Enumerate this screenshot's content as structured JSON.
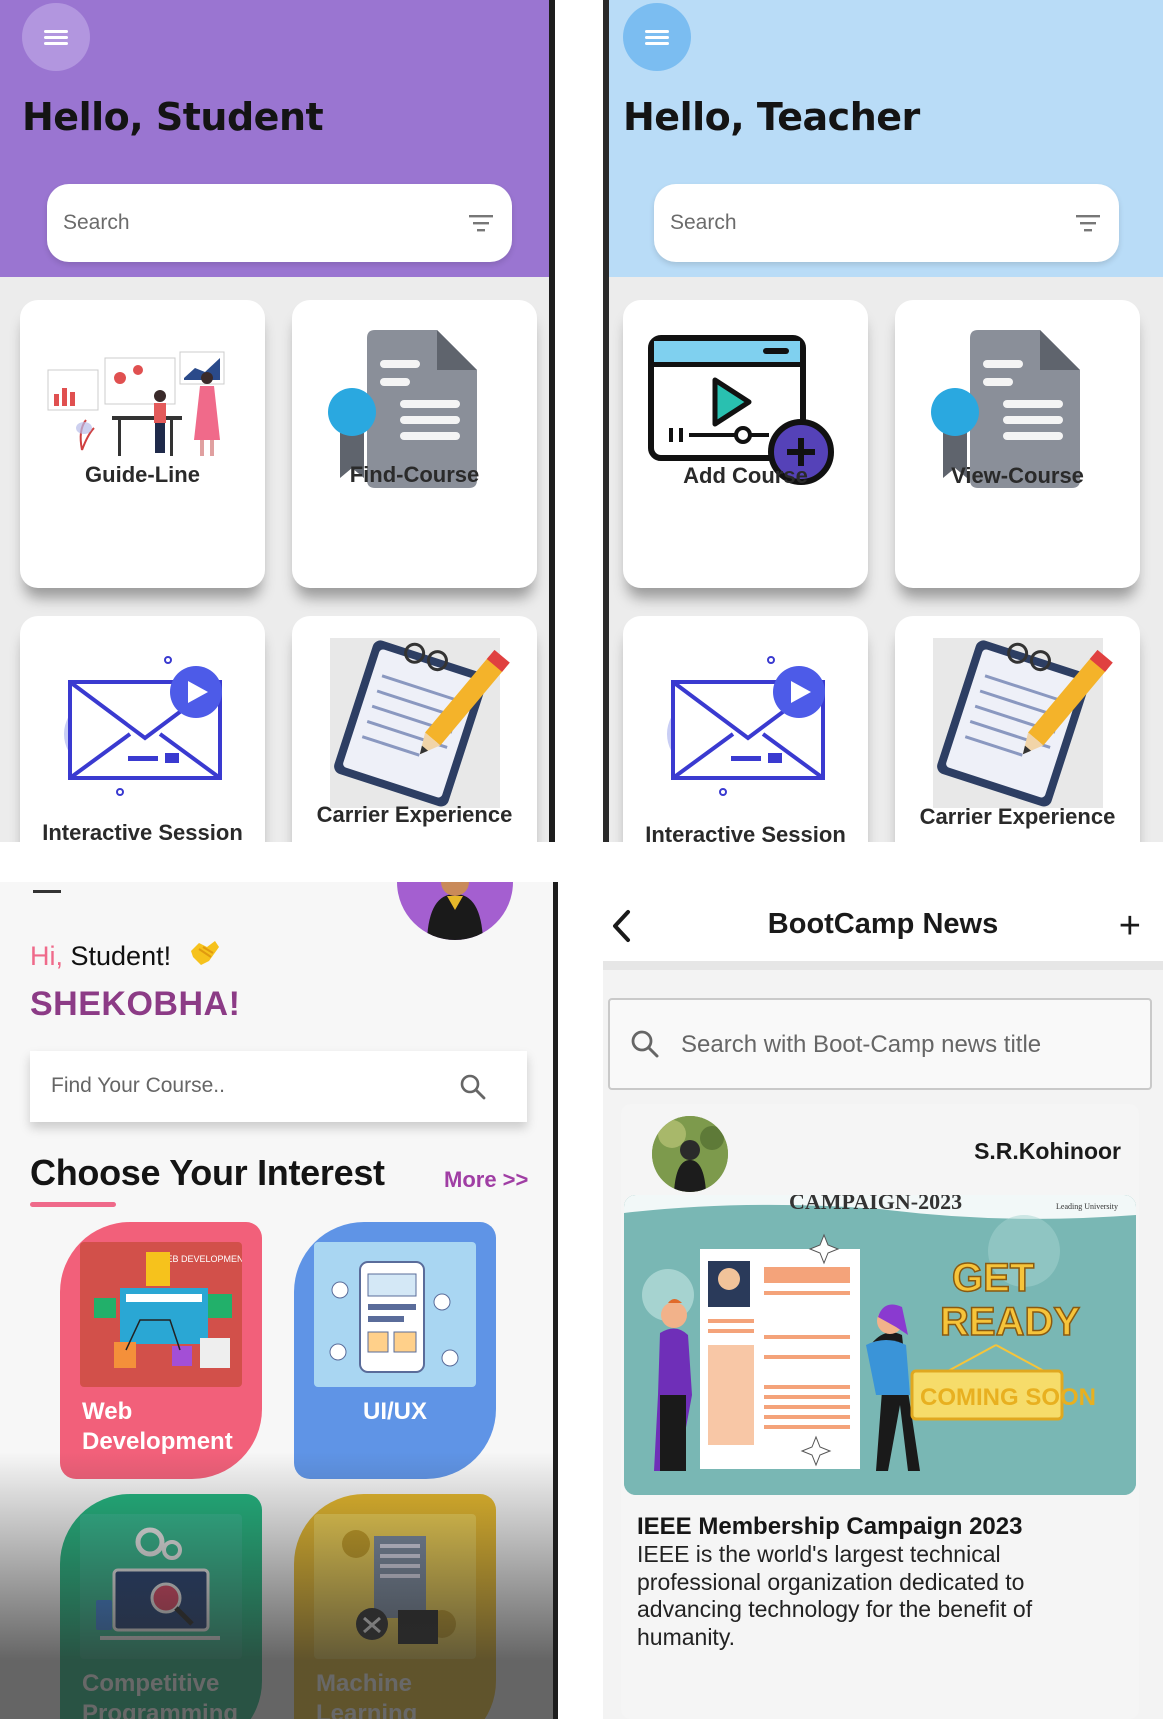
{
  "student_home": {
    "greeting": "Hello, Student",
    "search_placeholder": "Search",
    "cards": [
      {
        "label": "Guide-Line"
      },
      {
        "label": "Find-Course"
      },
      {
        "label": "Interactive Session"
      },
      {
        "label": "Carrier Experience"
      }
    ],
    "accent": "#9a75d1"
  },
  "teacher_home": {
    "greeting": "Hello, Teacher",
    "search_placeholder": "Search",
    "cards": [
      {
        "label": "Add Course"
      },
      {
        "label": "View-Course"
      },
      {
        "label": "Interactive Session"
      },
      {
        "label": "Carrier Experience"
      }
    ],
    "accent": "#b9dcf7"
  },
  "course_browser": {
    "greeting_hi": "Hi,",
    "greeting_name": "Student!",
    "brand": "SHEKOBHA!",
    "search_placeholder": "Find Your Course..",
    "section_title": "Choose Your Interest",
    "more_link": "More >>",
    "tiles": [
      {
        "label": "Web Development",
        "art_caption": "WEB DEVELOPMENT",
        "color": "#f2607a"
      },
      {
        "label": "UI/UX",
        "color": "#5f94e6"
      },
      {
        "label": "Competitive Programming",
        "color": "#1fb57e"
      },
      {
        "label": "Machine Learning",
        "color": "#e6b82a"
      }
    ]
  },
  "bootcamp_news": {
    "title": "BootCamp News",
    "search_placeholder": "Search with Boot-Camp news title",
    "post": {
      "author": "S.R.Kohinoor",
      "banner_caption": "CAMPAIGN-2023",
      "banner_logo": "Leading University",
      "banner_headline_1": "GET",
      "banner_headline_2": "READY",
      "banner_badge": "COMING SOON",
      "headline": "IEEE Membership Campaign 2023",
      "body": "IEEE is the world's largest technical professional organization dedicated to advancing technology for the benefit of humanity."
    }
  }
}
